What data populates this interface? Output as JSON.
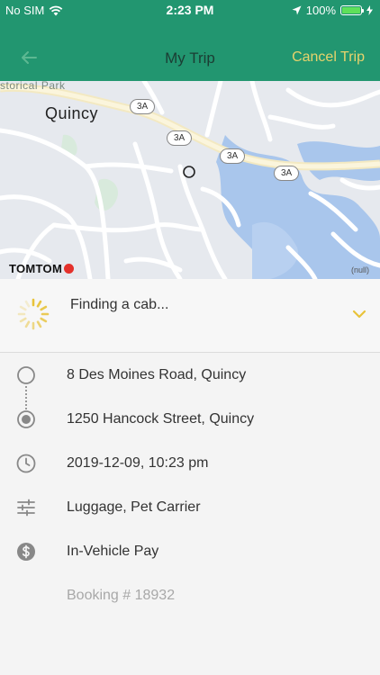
{
  "status_bar": {
    "carrier": "No SIM",
    "time": "2:23 PM",
    "battery": "100%",
    "battery_level": 1.0
  },
  "nav": {
    "back_icon": "arrow-left-icon",
    "title": "My Trip",
    "cancel_label": "Cancel Trip"
  },
  "map": {
    "park_label": "storical Park",
    "city_label": "Quincy",
    "route_badges": [
      "3A",
      "3A",
      "3A",
      "3A"
    ],
    "provider": "TOMTOM",
    "attribution": "(null)"
  },
  "finding": {
    "label": "Finding a cab...",
    "icons": [
      "spinner-icon",
      "chevron-down-icon"
    ],
    "accent_color": "#e8c33a"
  },
  "trip": {
    "pickup": "8 Des Moines Road, Quincy",
    "dropoff": "1250 Hancock Street, Quincy",
    "datetime": "2019-12-09, 10:23 pm",
    "extras": "Luggage, Pet Carrier",
    "payment": "In-Vehicle Pay",
    "booking": "Booking # 18932"
  },
  "colors": {
    "header": "#229670",
    "cancel": "#e7d36c",
    "water": "#a9c6ec",
    "road": "#ffffff"
  }
}
